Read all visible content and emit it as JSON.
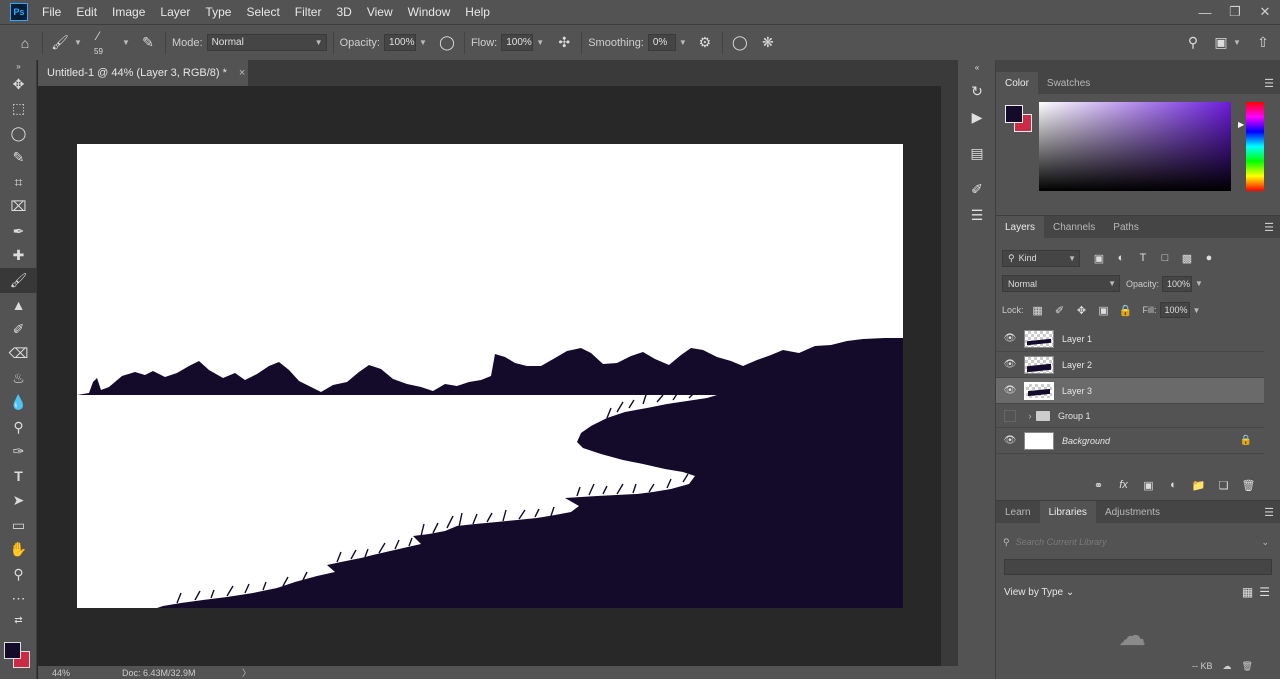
{
  "app": {
    "logo": "Ps",
    "menu": [
      "File",
      "Edit",
      "Image",
      "Layer",
      "Type",
      "Select",
      "Filter",
      "3D",
      "View",
      "Window",
      "Help"
    ],
    "window_controls": [
      "minimize-icon",
      "restore-icon",
      "close-icon"
    ]
  },
  "options": {
    "brush_size": "59",
    "mode_label": "Mode:",
    "mode_value": "Normal",
    "opacity_label": "Opacity:",
    "opacity_value": "100%",
    "flow_label": "Flow:",
    "flow_value": "100%",
    "smoothing_label": "Smoothing:",
    "smoothing_value": "0%"
  },
  "document": {
    "tab_title": "Untitled-1 @ 44% (Layer 3, RGB/8) *",
    "close_glyph": "×",
    "zoom": "44%",
    "doc_size": "Doc: 6.43M/32.9M",
    "status_arrow": "〉"
  },
  "colors": {
    "foreground": "#140a2a",
    "background": "#cc2b45",
    "silhouette": "#140a2a"
  },
  "color_panel": {
    "tabs": [
      "Color",
      "Swatches"
    ]
  },
  "layers_panel": {
    "tabs": [
      "Layers",
      "Channels",
      "Paths"
    ],
    "filter_label": "Kind",
    "blend_mode": "Normal",
    "opacity_label": "Opacity:",
    "opacity_value": "100%",
    "lock_label": "Lock:",
    "fill_label": "Fill:",
    "fill_value": "100%",
    "layers": [
      {
        "name": "Layer 1",
        "visible": true
      },
      {
        "name": "Layer 2",
        "visible": true
      },
      {
        "name": "Layer 3",
        "visible": true,
        "selected": true
      },
      {
        "name": "Group 1",
        "visible": false
      },
      {
        "name": "Background",
        "visible": true,
        "locked": true
      }
    ]
  },
  "libraries_panel": {
    "tabs": [
      "Learn",
      "Libraries",
      "Adjustments"
    ],
    "search_placeholder": "Search Current Library",
    "view_by": "View by Type",
    "size_readout": "-- KB"
  }
}
